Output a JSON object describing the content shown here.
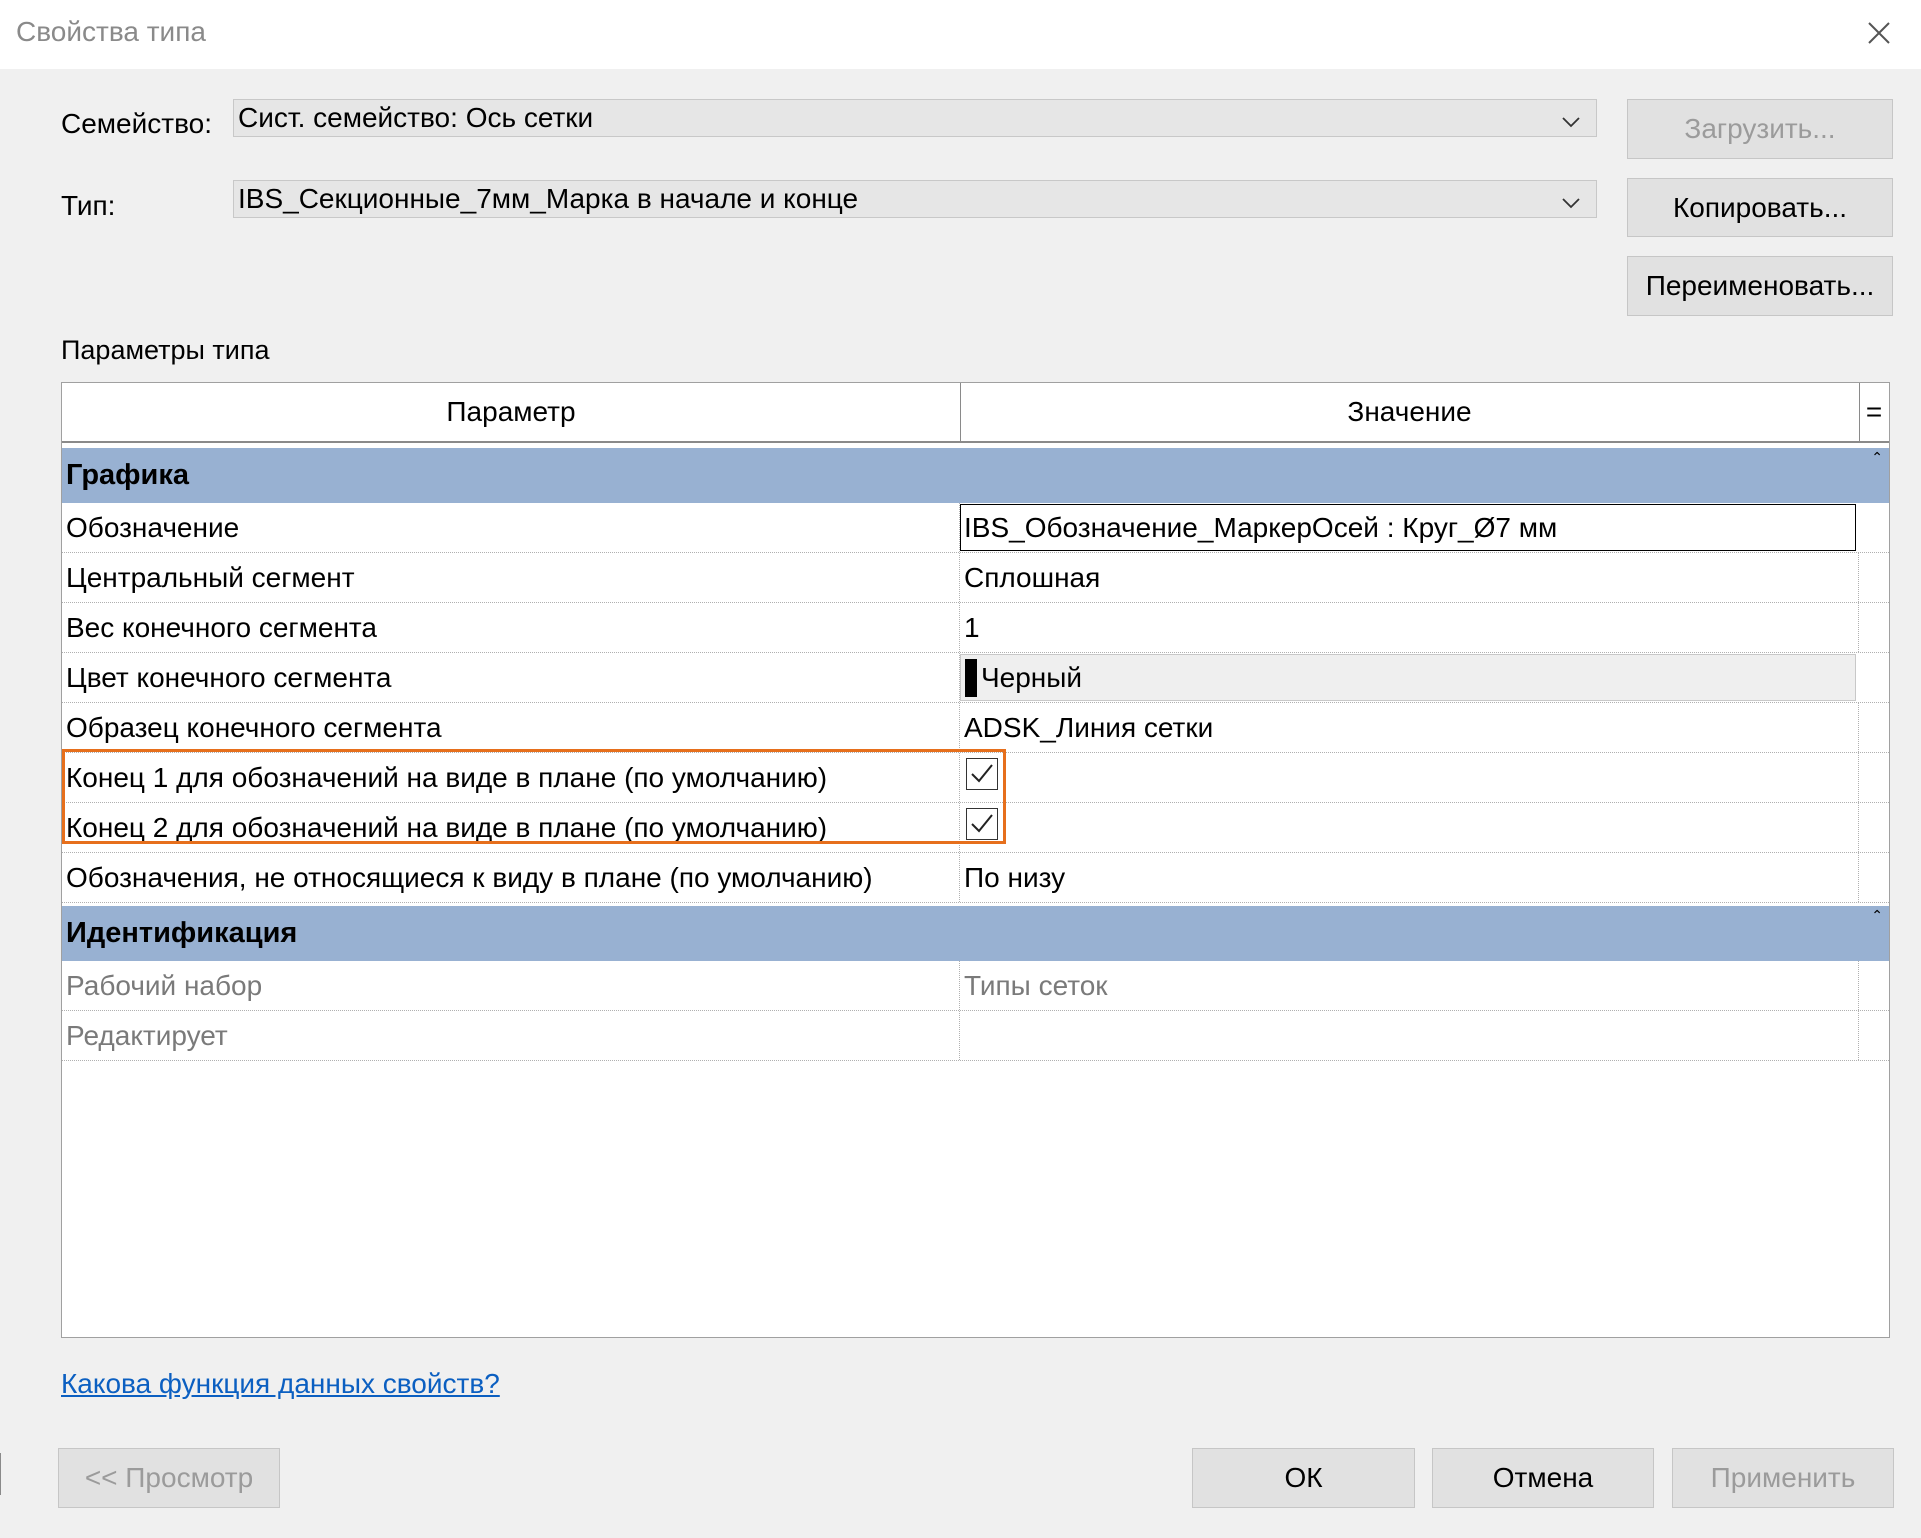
{
  "window": {
    "title": "Свойства типа"
  },
  "family": {
    "label": "Семейство:",
    "value": "Сист. семейство: Ось сетки"
  },
  "type": {
    "label": "Тип:",
    "value": "IBS_Секционные_7мм_Марка в начале и конце"
  },
  "buttons": {
    "load": "Загрузить...",
    "copy": "Копировать...",
    "rename": "Переименовать...",
    "preview": "<< Просмотр",
    "ok": "ОК",
    "cancel": "Отмена",
    "apply": "Применить"
  },
  "section_title": "Параметры типа",
  "table": {
    "header_param": "Параметр",
    "header_value": "Значение",
    "header_eq": "=",
    "groups": [
      {
        "name": "Графика",
        "rows": [
          {
            "param": "Обозначение",
            "value": "IBS_Обозначение_МаркерОсей : Круг_Ø7 мм"
          },
          {
            "param": "Центральный сегмент",
            "value": "Сплошная"
          },
          {
            "param": "Вес конечного сегмента",
            "value": "1"
          },
          {
            "param": "Цвет конечного сегмента",
            "value": "Черный"
          },
          {
            "param": "Образец конечного сегмента",
            "value": "ADSK_Линия сетки"
          },
          {
            "param": "Конец 1 для обозначений на виде в плане (по умолчанию)",
            "checked": true
          },
          {
            "param": "Конец 2 для обозначений на виде в плане (по умолчанию)",
            "checked": true
          },
          {
            "param": "Обозначения, не относящиеся к виду в плане (по умолчанию)",
            "value": "По низу"
          }
        ]
      },
      {
        "name": "Идентификация",
        "rows": [
          {
            "param": "Рабочий набор",
            "value": "Типы сеток"
          },
          {
            "param": "Редактирует",
            "value": ""
          }
        ]
      }
    ]
  },
  "help_link": "Какова функция данных свойств?",
  "colors": {
    "group_header": "#98b1d2",
    "highlight": "#e66f1c",
    "link": "#0b5fc1"
  }
}
